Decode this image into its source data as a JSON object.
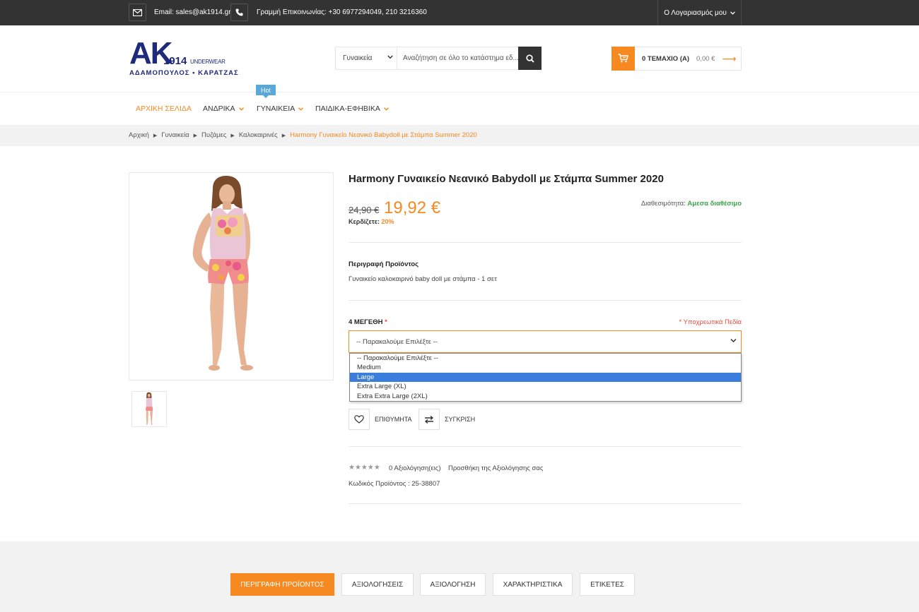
{
  "topbar": {
    "email": "Email: sales@ak1914.gr",
    "phone": "Γραμμή Επικοινωνίας: +30 6977294049, 210 3216360",
    "account": "Ο Λογαριασμός μου"
  },
  "logo": {
    "main": "AK",
    "number": "1914",
    "tag": "UNDERWEAR",
    "subtitle": "ΑΔΑΜΟΠΟΥΛΟΣ • ΚΑΡΑΤΖΑΣ"
  },
  "search": {
    "category": "Γυναικεία",
    "placeholder": "Αναζήτηση σε όλο το κατάστημα εδ..."
  },
  "cart": {
    "items": "0 ΤΕΜΑΧΙΟ (Α)",
    "total": "0,00 €"
  },
  "nav": {
    "hot_badge": "Hot",
    "items": [
      "ΑΡΧΙΚΗ ΣΕΛΙΔΑ",
      "ΑΝΔΡΙΚΑ",
      "ΓΥΝΑΙΚΕΙΑ",
      "ΠΑΙΔΙΚΑ-ΕΦΗΒΙΚΑ"
    ]
  },
  "breadcrumb": [
    "Αρχική",
    "Γυναικεία",
    "Πυζάμες",
    "Καλοκαιρινές",
    "Harmony Γυναικείο Νεανικό Babydoll με Στάμπα Summer 2020"
  ],
  "product": {
    "title": "Harmony Γυναικείο Νεανικό Babydoll με Στάμπα Summer 2020",
    "old_price": "24,90 €",
    "new_price": "19,92 €",
    "save_label": "Κερδίζετε:",
    "save_value": "20%",
    "availability_label": "Διαθεσιμότητα:",
    "availability_value": "Αμεσα διαθέσιμο",
    "desc_heading": "Περιγραφή Προϊόντος",
    "desc_text": "Γυναικείο καλοκαιρινό baby doll με στάμπα - 1 σετ",
    "option_label": "4 ΜΕΓΕΘΗ",
    "option_req_mark": "*",
    "required_note": "* Υποχρεωτικά Πεδία",
    "select_value": "-- Παρακαλούμε Επιλέξτε --",
    "options": [
      "-- Παρακαλούμε Επιλέξτε --",
      "Medium",
      "Large",
      "Extra Large (XL)",
      "Extra Extra Large (2XL)"
    ],
    "selected_option": "Large",
    "wishlist": "ΕΠΙΘΥΜΗΤΑ",
    "compare": "ΣΥΓΚΡΙΣΗ",
    "stars": "★★★★★",
    "reviews_count": "0 Αξιολόγηση(εις)",
    "add_review": "Προσθήκη της Αξιολόγησης σας",
    "code": "Κωδικός Προϊόντος : 25-38807"
  },
  "tabs": [
    "ΠΕΡΙΓΡΑΦΗ ΠΡΟΪΟΝΤΟΣ",
    "ΑΞΙΟΛΟΓΗΣΕΙΣ",
    "ΑΞΙΟΛΟΓΗΣΗ",
    "ΧΑΡΑΚΤΗΡΙΣΤΙΚΑ",
    "ΕΤΙΚΕΤΕΣ"
  ],
  "colors": {
    "accent": "#f6891f",
    "dark": "#333333",
    "brand": "#1e2a7a",
    "stock": "#3aa54a",
    "required": "#e84c3d",
    "hot": "#5aa7d8"
  }
}
